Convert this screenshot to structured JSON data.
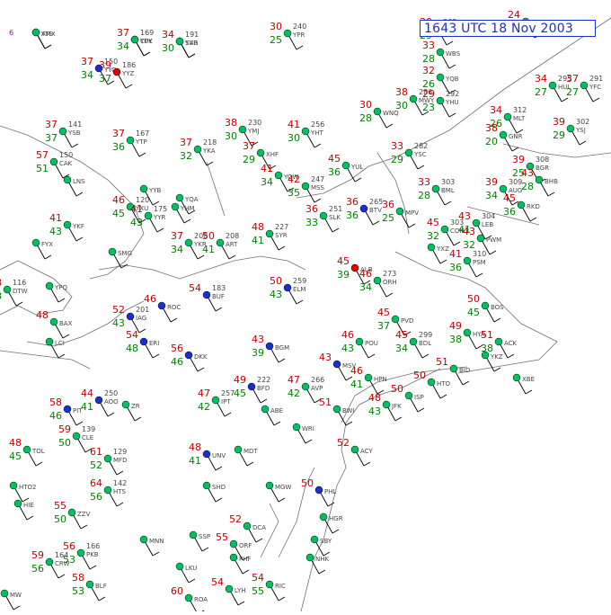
{
  "title": "1643 UTC 18 Nov 2003",
  "colors": {
    "temperature": "#c00000",
    "dewpoint": "#008000",
    "station_id": "#444444",
    "pressure": "#444444",
    "coastline": "#707070",
    "clear": "#00c060",
    "light_rain": "#1a2fd0",
    "moderate_rain": "#c000c0",
    "heavy_rain": "#e00000",
    "fog": "#9900cc",
    "title": "#1a2fd0"
  },
  "stations": [
    {
      "id": "YTS",
      "t": "",
      "td": "",
      "p": "",
      "sym": "clear",
      "wx": "6"
    },
    {
      "id": "YUY",
      "t": "37",
      "td": "34",
      "p": "169",
      "sym": "blue"
    },
    {
      "id": "YVD",
      "t": "34",
      "td": "30",
      "p": "191",
      "sym": "blue"
    },
    {
      "id": "YPR",
      "t": "30",
      "td": "25",
      "p": "240",
      "sym": "clear"
    },
    {
      "id": "YYC",
      "t": "37",
      "td": "34",
      "p": "150",
      "sym": "blue"
    },
    {
      "id": "YYZ",
      "t": "39",
      "td": "37",
      "p": "186",
      "sym": "red"
    },
    {
      "id": "YSB",
      "t": "37",
      "td": "37",
      "p": "141",
      "sym": "clear"
    },
    {
      "id": "YTP",
      "t": "37",
      "td": "36",
      "p": "167",
      "sym": "clear"
    },
    {
      "id": "YMJ",
      "t": "38",
      "td": "30",
      "p": "230",
      "sym": "clear"
    },
    {
      "id": "YHT",
      "t": "41",
      "td": "30",
      "p": "256",
      "sym": "clear"
    },
    {
      "id": "YKA",
      "t": "37",
      "td": "32",
      "p": "218",
      "sym": "clear"
    },
    {
      "id": "XHF",
      "t": "37",
      "td": "29",
      "p": "",
      "sym": "clear"
    },
    {
      "id": "YOW",
      "t": "41",
      "td": "34",
      "p": "",
      "sym": "clear"
    },
    {
      "id": "MSS",
      "t": "42",
      "td": "35",
      "p": "247",
      "sym": "clear"
    },
    {
      "id": "YUL",
      "t": "45",
      "td": "36",
      "p": "",
      "sym": "clear"
    },
    {
      "id": "WST",
      "t": "30",
      "td": "29",
      "p": "268",
      "sym": "clear"
    },
    {
      "id": "WBS",
      "t": "33",
      "td": "28",
      "p": "",
      "sym": "clear"
    },
    {
      "id": "YQB",
      "t": "32",
      "td": "26",
      "p": "",
      "sym": "clear"
    },
    {
      "id": "WNQ",
      "t": "30",
      "td": "28",
      "p": "",
      "sym": "clear"
    },
    {
      "id": "MWY",
      "t": "38",
      "td": "30",
      "p": "286",
      "sym": "clear"
    },
    {
      "id": "YHU",
      "t": "29",
      "td": "23",
      "p": "292",
      "sym": "clear"
    },
    {
      "id": "CAR",
      "t": "24",
      "td": "22",
      "p": "",
      "sym": "clear"
    },
    {
      "id": "HUL",
      "t": "34",
      "td": "27",
      "p": "295",
      "sym": "clear"
    },
    {
      "id": "YFC",
      "t": "37",
      "td": "27",
      "p": "291",
      "sym": "clear"
    },
    {
      "id": "MLT",
      "t": "34",
      "td": "26",
      "p": "312",
      "sym": "clear"
    },
    {
      "id": "GNR",
      "t": "38",
      "td": "20",
      "p": "",
      "sym": "clear"
    },
    {
      "id": "YSJ",
      "t": "39",
      "td": "29",
      "p": "302",
      "sym": "clear"
    },
    {
      "id": "YSC",
      "t": "33",
      "td": "29",
      "p": "282",
      "sym": "clear"
    },
    {
      "id": "BML",
      "t": "33",
      "td": "28",
      "p": "303",
      "sym": "clear"
    },
    {
      "id": "AUG",
      "t": "39",
      "td": "34",
      "p": "309",
      "sym": "clear"
    },
    {
      "id": "BGR",
      "t": "39",
      "td": "25",
      "p": "308",
      "sym": "clear"
    },
    {
      "id": "BHB",
      "t": "43",
      "td": "28",
      "p": "",
      "sym": "clear"
    },
    {
      "id": "RKD",
      "t": "45",
      "td": "36",
      "p": "",
      "sym": "clear"
    },
    {
      "id": "LEB",
      "t": "43",
      "td": "41",
      "p": "304",
      "sym": "clear"
    },
    {
      "id": "PWM",
      "t": "43",
      "td": "32",
      "p": "",
      "sym": "clear"
    },
    {
      "id": "SLK",
      "t": "36",
      "td": "33",
      "p": "251",
      "sym": "clear"
    },
    {
      "id": "BTV",
      "t": "36",
      "td": "36",
      "p": "265",
      "sym": "blue"
    },
    {
      "id": "MPV",
      "t": "36",
      "td": "25",
      "p": "",
      "sym": "clear"
    },
    {
      "id": "CON",
      "t": "45",
      "td": "32",
      "p": "303",
      "sym": "clear"
    },
    {
      "id": "PSM",
      "t": "41",
      "td": "36",
      "p": "310",
      "sym": "clear"
    },
    {
      "id": "BOS",
      "t": "50",
      "td": "45",
      "p": "",
      "sym": "clear"
    },
    {
      "id": "ALB",
      "t": "45",
      "td": "39",
      "p": "",
      "sym": "red"
    },
    {
      "id": "ORH",
      "t": "46",
      "td": "34",
      "p": "273",
      "sym": "clear"
    },
    {
      "id": "PVD",
      "t": "45",
      "td": "37",
      "p": "",
      "sym": "clear"
    },
    {
      "id": "HYA",
      "t": "49",
      "td": "38",
      "p": "",
      "sym": "clear"
    },
    {
      "id": "ACK",
      "t": "51",
      "td": "38",
      "p": "",
      "sym": "clear"
    },
    {
      "id": "BDL",
      "t": "45",
      "td": "34",
      "p": "299",
      "sym": "clear"
    },
    {
      "id": "BID",
      "t": "51",
      "td": "",
      "p": "",
      "sym": "clear"
    },
    {
      "id": "HTO",
      "t": "50",
      "td": "",
      "p": "",
      "sym": "clear"
    },
    {
      "id": "JFK",
      "t": "48",
      "td": "43",
      "p": "",
      "sym": "clear"
    },
    {
      "id": "ISP",
      "t": "50",
      "td": "",
      "p": "",
      "sym": "clear"
    },
    {
      "id": "HPN",
      "t": "46",
      "td": "41",
      "p": "",
      "sym": "clear"
    },
    {
      "id": "POU",
      "t": "46",
      "td": "43",
      "p": "",
      "sym": "clear"
    },
    {
      "id": "MSV",
      "t": "43",
      "td": "",
      "p": "",
      "sym": "blue"
    },
    {
      "id": "AVP",
      "t": "47",
      "td": "42",
      "p": "266",
      "sym": "clear"
    },
    {
      "id": "ELM",
      "t": "50",
      "td": "43",
      "p": "259",
      "sym": "blue"
    },
    {
      "id": "BGM",
      "t": "43",
      "td": "39",
      "p": "",
      "sym": "blue"
    },
    {
      "id": "SYR",
      "t": "48",
      "td": "41",
      "p": "227",
      "sym": "clear"
    },
    {
      "id": "ART",
      "t": "50",
      "td": "41",
      "p": "208",
      "sym": "clear"
    },
    {
      "id": "ROC",
      "t": "46",
      "td": "",
      "p": "",
      "sym": "blue"
    },
    {
      "id": "BUF",
      "t": "54",
      "td": "",
      "p": "183",
      "sym": "blue"
    },
    {
      "id": "IAG",
      "t": "52",
      "td": "43",
      "p": "201",
      "sym": "blue"
    },
    {
      "id": "ERI",
      "t": "54",
      "td": "48",
      "p": "",
      "sym": "blue"
    },
    {
      "id": "DKK",
      "t": "56",
      "td": "46",
      "p": "",
      "sym": "blue"
    },
    {
      "id": "BFD",
      "t": "49",
      "td": "45",
      "p": "222",
      "sym": "blue"
    },
    {
      "id": "IPT",
      "t": "47",
      "td": "42",
      "p": "257",
      "sym": "clear"
    },
    {
      "id": "UNV",
      "t": "48",
      "td": "41",
      "p": "",
      "sym": "blue"
    },
    {
      "id": "AOO",
      "t": "44",
      "td": "41",
      "p": "250",
      "sym": "blue"
    },
    {
      "id": "PIT",
      "t": "58",
      "td": "46",
      "p": "",
      "sym": "blue"
    },
    {
      "id": "CLE",
      "t": "59",
      "td": "50",
      "p": "139",
      "sym": "clear"
    },
    {
      "id": "CAK",
      "t": "57",
      "td": "51",
      "p": "150",
      "sym": "clear"
    },
    {
      "id": "YKF",
      "t": "41",
      "td": "43",
      "p": "",
      "sym": "clear"
    },
    {
      "id": "YXU",
      "t": "46",
      "td": "45",
      "p": "120",
      "sym": "clear"
    },
    {
      "id": "YYR",
      "t": "41",
      "td": "43",
      "p": "175",
      "sym": "clear"
    },
    {
      "id": "YQA",
      "t": "",
      "td": "",
      "p": "",
      "sym": "clear"
    },
    {
      "id": "YKR",
      "t": "37",
      "td": "34",
      "p": "208",
      "sym": "clear"
    },
    {
      "id": "YPQ",
      "t": "",
      "td": "",
      "p": "",
      "sym": "clear"
    },
    {
      "id": "DTW",
      "t": "48",
      "td": "48",
      "p": "116",
      "sym": "clear"
    },
    {
      "id": "BAX",
      "t": "48",
      "td": "",
      "p": "",
      "sym": "clear"
    },
    {
      "id": "TOL",
      "t": "48",
      "td": "45",
      "p": "",
      "sym": "clear"
    },
    {
      "id": "MFD",
      "t": "61",
      "td": "52",
      "p": "129",
      "sym": "clear"
    },
    {
      "id": "ZZV",
      "t": "55",
      "td": "50",
      "p": "",
      "sym": "clear"
    },
    {
      "id": "PKB",
      "t": "56",
      "td": "53",
      "p": "166",
      "sym": "clear"
    },
    {
      "id": "CRW",
      "t": "59",
      "td": "56",
      "p": "164",
      "sym": "clear"
    },
    {
      "id": "HTS",
      "t": "64",
      "td": "56",
      "p": "142",
      "sym": "clear"
    },
    {
      "id": "BLF",
      "t": "58",
      "td": "53",
      "p": "",
      "sym": "clear"
    },
    {
      "id": "ROA",
      "t": "60",
      "td": "",
      "p": "",
      "sym": "clear"
    },
    {
      "id": "LYH",
      "t": "54",
      "td": "",
      "p": "",
      "sym": "clear"
    },
    {
      "id": "RIC",
      "t": "54",
      "td": "55",
      "p": "",
      "sym": "clear"
    },
    {
      "id": "ORF",
      "t": "55",
      "td": "",
      "p": "",
      "sym": "clear"
    },
    {
      "id": "DCA",
      "t": "52",
      "td": "",
      "p": "",
      "sym": "clear"
    },
    {
      "id": "BWI",
      "t": "51",
      "td": "",
      "p": "",
      "sym": "clear"
    },
    {
      "id": "PHL",
      "t": "50",
      "td": "",
      "p": "",
      "sym": "blue"
    },
    {
      "id": "ACY",
      "t": "52",
      "td": "",
      "p": "",
      "sym": "clear"
    },
    {
      "id": "WRI",
      "t": "",
      "td": "",
      "p": "",
      "sym": "clear"
    },
    {
      "id": "ABE",
      "t": "",
      "td": "",
      "p": "",
      "sym": "clear"
    },
    {
      "id": "MDT",
      "t": "",
      "td": "",
      "p": "",
      "sym": "clear"
    },
    {
      "id": "HGR",
      "t": "",
      "td": "",
      "p": "",
      "sym": "clear"
    },
    {
      "id": "SBY",
      "t": "",
      "td": "",
      "p": "",
      "sym": "clear"
    },
    {
      "id": "NHK",
      "t": "",
      "td": "",
      "p": "",
      "sym": "clear"
    },
    {
      "id": "PHF",
      "t": "",
      "td": "",
      "p": "",
      "sym": "clear"
    },
    {
      "id": "SSP",
      "t": "",
      "td": "",
      "p": "",
      "sym": "clear"
    },
    {
      "id": "LKU",
      "t": "",
      "td": "",
      "p": "",
      "sym": "clear"
    },
    {
      "id": "MGW",
      "t": "",
      "td": "",
      "p": "",
      "sym": "clear"
    },
    {
      "id": "SHD",
      "t": "",
      "td": "",
      "p": "",
      "sym": "clear"
    },
    {
      "id": "LNS",
      "t": "",
      "td": "",
      "p": "",
      "sym": "clear"
    },
    {
      "id": "SMG",
      "t": "",
      "td": "",
      "p": "",
      "sym": "clear"
    },
    {
      "id": "FYX",
      "t": "",
      "td": "",
      "p": "",
      "sym": "clear"
    },
    {
      "id": "YYB",
      "t": "",
      "td": "",
      "p": "",
      "sym": "clear"
    },
    {
      "id": "YHM",
      "t": "",
      "td": "",
      "p": "",
      "sym": "clear"
    },
    {
      "id": "YXZ",
      "t": "",
      "td": "",
      "p": "",
      "sym": "clear"
    },
    {
      "id": "YKZ",
      "t": "",
      "td": "",
      "p": "",
      "sym": "clear"
    },
    {
      "id": "XBE",
      "t": "",
      "td": "",
      "p": "",
      "sym": "clear"
    },
    {
      "id": "LCI",
      "t": "",
      "td": "",
      "p": "",
      "sym": "clear"
    },
    {
      "id": "HTO2",
      "t": "",
      "td": "",
      "p": "",
      "sym": "clear"
    },
    {
      "id": "HIE",
      "t": "",
      "td": "",
      "p": "",
      "sym": "clear"
    },
    {
      "id": "ZR",
      "t": "",
      "td": "",
      "p": "",
      "sym": "clear"
    },
    {
      "id": "MNN",
      "t": "",
      "td": "",
      "p": "",
      "sym": "clear"
    },
    {
      "id": "MW",
      "t": "",
      "td": "",
      "p": "",
      "sym": "clear"
    },
    {
      "id": "AMX",
      "t": "",
      "td": "",
      "p": "",
      "sym": "clear"
    },
    {
      "id": "CPK",
      "t": "",
      "td": "",
      "p": "",
      "sym": "clear"
    },
    {
      "id": "SAR",
      "t": "",
      "td": "",
      "p": "",
      "sym": "clear"
    }
  ]
}
